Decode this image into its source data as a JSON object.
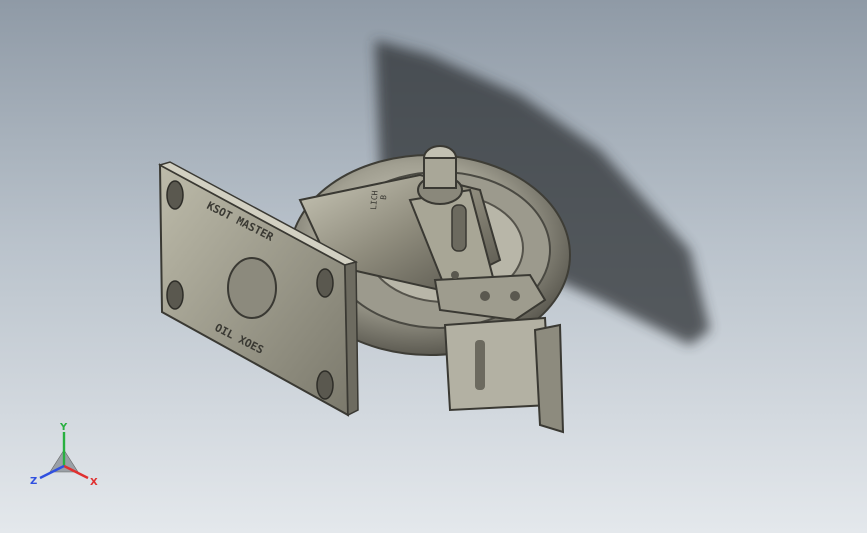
{
  "scene": {
    "model_name": "caster assembly",
    "plate_text_top": "KSOT MASTER",
    "plate_text_bottom": "OIL XOES",
    "fork_text_1": "B",
    "fork_text_2": "LICH"
  },
  "triad": {
    "x_label": "X",
    "y_label": "Y",
    "z_label": "Z",
    "x_color": "#e03030",
    "y_color": "#28b040",
    "z_color": "#3050e0"
  }
}
